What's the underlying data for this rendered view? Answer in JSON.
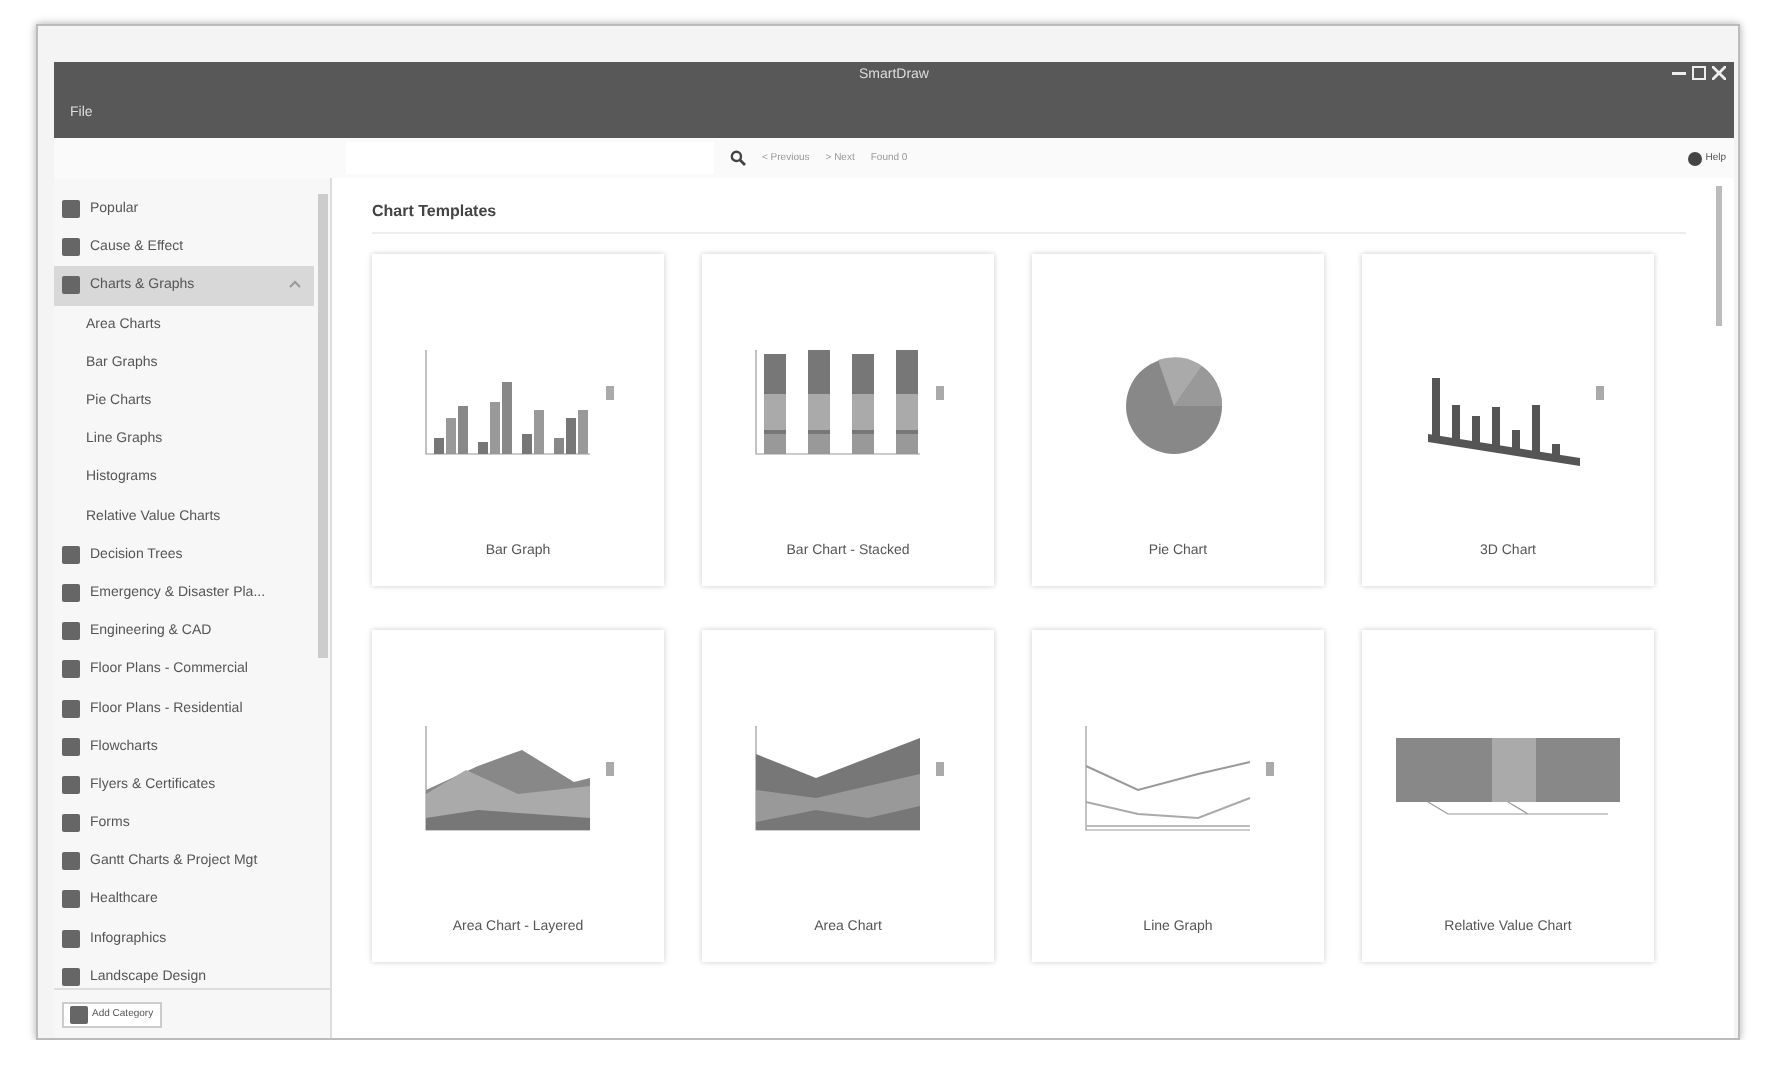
{
  "window": {
    "title": "SmartDraw",
    "menu": [
      "File"
    ]
  },
  "toolbar": {
    "previous": "< Previous",
    "next": "> Next",
    "found": "Found 0",
    "help": "Help"
  },
  "sidebar": {
    "items": [
      {
        "label": "Popular",
        "selected": false
      },
      {
        "label": "Cause & Effect",
        "selected": false
      },
      {
        "label": "Charts & Graphs",
        "selected": true,
        "expanded": true,
        "children": [
          {
            "label": "Area Charts",
            "selected": false
          },
          {
            "label": "Bar Graphs",
            "selected": false
          },
          {
            "label": "Pie Charts",
            "selected": false
          },
          {
            "label": "Line Graphs",
            "selected": false
          },
          {
            "label": "Histograms",
            "selected": false
          },
          {
            "label": "Relative Value Charts",
            "selected": false
          }
        ]
      },
      {
        "label": "Decision Trees",
        "selected": false
      },
      {
        "label": "Emergency & Disaster Pla...",
        "selected": false
      },
      {
        "label": "Engineering & CAD",
        "selected": false
      },
      {
        "label": "Floor Plans - Commercial",
        "selected": false
      },
      {
        "label": "Floor Plans - Residential",
        "selected": false
      },
      {
        "label": "Flowcharts",
        "selected": false
      },
      {
        "label": "Flyers & Certificates",
        "selected": false
      },
      {
        "label": "Forms",
        "selected": false
      },
      {
        "label": "Gantt Charts & Project Mgt",
        "selected": false
      },
      {
        "label": "Healthcare",
        "selected": false
      },
      {
        "label": "Infographics",
        "selected": false
      },
      {
        "label": "Landscape Design",
        "selected": false
      }
    ],
    "add_category": "Add Category"
  },
  "content": {
    "heading": "Chart Templates",
    "templates": [
      {
        "label": "Bar Graph",
        "kind": "bar"
      },
      {
        "label": "Bar Chart - Stacked",
        "kind": "stacked"
      },
      {
        "label": "Pie Chart",
        "kind": "pie"
      },
      {
        "label": "3D Chart",
        "kind": "bar3d"
      },
      {
        "label": "Area Chart - Layered",
        "kind": "layered"
      },
      {
        "label": "Area Chart",
        "kind": "area"
      },
      {
        "label": "Line Graph",
        "kind": "line"
      },
      {
        "label": "Relative Value Chart",
        "kind": "relative"
      }
    ]
  }
}
